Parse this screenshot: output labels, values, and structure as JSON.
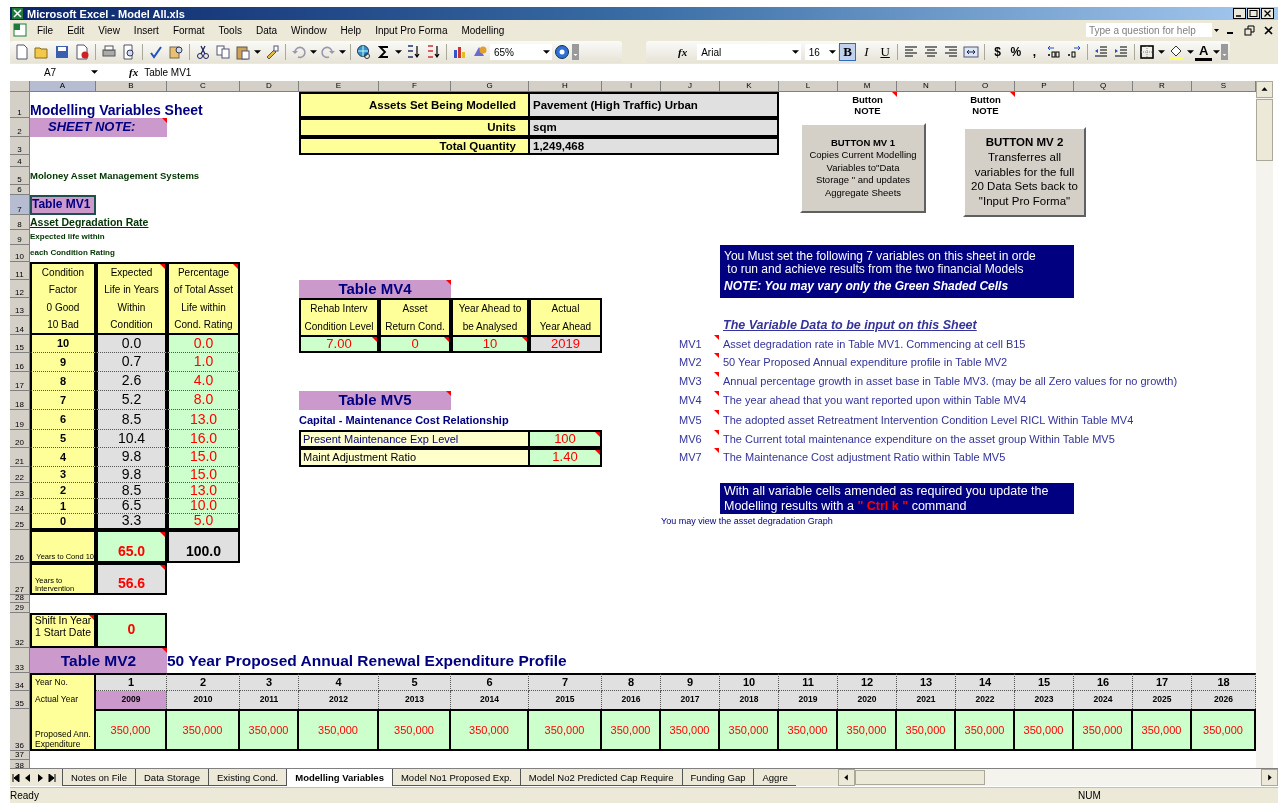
{
  "window": {
    "title": "Microsoft Excel - Model All.xls"
  },
  "menu_bar": [
    "File",
    "Edit",
    "View",
    "Insert",
    "Format",
    "Tools",
    "Data",
    "Window",
    "Help",
    "Input Pro Forma",
    "Modelling"
  ],
  "help_box": {
    "placeholder": "Type a question for help"
  },
  "toolbar": {
    "function_label": "fx",
    "zoom": "65%",
    "font": "Arial",
    "font_size": "16",
    "style_buttons": [
      {
        "label": "B",
        "pressed": true
      },
      {
        "label": "I",
        "pressed": false
      },
      {
        "label": "U",
        "pressed": false
      }
    ],
    "number_buttons": [
      "$",
      "%",
      ","
    ],
    "font_color_label": "A"
  },
  "formula_bar": {
    "cell": "A7",
    "function_label": "fx",
    "content": "Table MV1"
  },
  "column_headers": [
    {
      "label": "A",
      "selected": true
    },
    {
      "label": "B",
      "selected": false
    },
    {
      "label": "C",
      "selected": false
    },
    {
      "label": "D",
      "selected": false
    },
    {
      "label": "E",
      "selected": false
    },
    {
      "label": "F",
      "selected": false
    },
    {
      "label": "G",
      "selected": false
    },
    {
      "label": "H",
      "selected": false
    },
    {
      "label": "I",
      "selected": false
    },
    {
      "label": "J",
      "selected": false
    },
    {
      "label": "K",
      "selected": false
    },
    {
      "label": "L",
      "selected": false
    },
    {
      "label": "M",
      "selected": false
    },
    {
      "label": "N",
      "selected": false
    },
    {
      "label": "O",
      "selected": false
    },
    {
      "label": "P",
      "selected": false
    },
    {
      "label": "Q",
      "selected": false
    },
    {
      "label": "R",
      "selected": false
    },
    {
      "label": "S",
      "selected": false
    }
  ],
  "row_headers": [
    {
      "label": "1",
      "selected": false
    },
    {
      "label": "2",
      "selected": false
    },
    {
      "label": "3",
      "selected": false
    },
    {
      "label": "4",
      "selected": false
    },
    {
      "label": "5",
      "selected": false
    },
    {
      "label": "6",
      "selected": false
    },
    {
      "label": "7",
      "selected": true
    },
    {
      "label": "8",
      "selected": false
    },
    {
      "label": "9",
      "selected": false
    },
    {
      "label": "10",
      "selected": false
    },
    {
      "label": "11",
      "selected": false
    },
    {
      "label": "12",
      "selected": false
    },
    {
      "label": "13",
      "selected": false
    },
    {
      "label": "14",
      "selected": false
    },
    {
      "label": "15",
      "selected": false
    },
    {
      "label": "16",
      "selected": false
    },
    {
      "label": "17",
      "selected": false
    },
    {
      "label": "18",
      "selected": false
    },
    {
      "label": "19",
      "selected": false
    },
    {
      "label": "20",
      "selected": false
    },
    {
      "label": "21",
      "selected": false
    },
    {
      "label": "22",
      "selected": false
    },
    {
      "label": "23",
      "selected": false
    },
    {
      "label": "24",
      "selected": false
    },
    {
      "label": "25",
      "selected": false
    },
    {
      "label": "26",
      "selected": false
    },
    {
      "label": "27",
      "selected": false
    },
    {
      "label": "28",
      "selected": false
    },
    {
      "label": "29",
      "selected": false
    },
    {
      "label": "32",
      "selected": false
    },
    {
      "label": "33",
      "selected": false
    },
    {
      "label": "34",
      "selected": false
    },
    {
      "label": "35",
      "selected": false
    },
    {
      "label": "36",
      "selected": false
    },
    {
      "label": "37",
      "selected": false
    },
    {
      "label": "38",
      "selected": false
    }
  ],
  "sheet": {
    "title": "Modelling Variables Sheet",
    "sheet_note": {
      "text": "SHEET NOTE:",
      "comment": true
    },
    "company": "Moloney Asset Management Systems",
    "assets_table": [
      {
        "label": "Assets Set Being Modelled",
        "value": "Pavement (High Traffic) Urban"
      },
      {
        "label": "Units",
        "value": "sqm"
      },
      {
        "label": "Total Quantity",
        "value": "1,249,468"
      }
    ],
    "button_notes": [
      {
        "lines": [
          "Button",
          "NOTE"
        ],
        "comment": true
      },
      {
        "lines": [
          "Button",
          "NOTE"
        ],
        "comment": true
      }
    ],
    "buttons": [
      {
        "title": "BUTTON MV 1",
        "lines": [
          "Copies Current Modelling",
          "Variables to\"Data",
          "Storage \" and updates",
          "Aggregate Sheets"
        ]
      },
      {
        "title": "BUTTON MV 2",
        "lines": [
          "Transferres all",
          "variables for the full",
          "20 Data Sets back to",
          "\"Input Pro Forma\""
        ]
      }
    ],
    "mv1": {
      "title": "Table MV1",
      "subtitle": "Asset Degradation Rate",
      "caption": [
        "Expected life within",
        "each Condition Rating"
      ],
      "headers": [
        {
          "lines": [
            "Condition",
            "Factor",
            "0 Good",
            "10 Bad"
          ],
          "comment": false
        },
        {
          "lines": [
            "Expected",
            "Life in Years",
            "Within",
            "Condition"
          ],
          "comment": true
        },
        {
          "lines": [
            "Percentage",
            "of Total Asset",
            "Life within",
            "Cond. Rating"
          ],
          "comment": true
        }
      ],
      "rows": [
        {
          "factor": "10",
          "life": "0.0",
          "percent": "0.0"
        },
        {
          "factor": "9",
          "life": "0.7",
          "percent": "1.0"
        },
        {
          "factor": "8",
          "life": "2.6",
          "percent": "4.0"
        },
        {
          "factor": "7",
          "life": "5.2",
          "percent": "8.0"
        },
        {
          "factor": "6",
          "life": "8.5",
          "percent": "13.0"
        },
        {
          "factor": "5",
          "life": "10.4",
          "percent": "16.0"
        },
        {
          "factor": "4",
          "life": "9.8",
          "percent": "15.0"
        },
        {
          "factor": "3",
          "life": "9.8",
          "percent": "15.0"
        },
        {
          "factor": "2",
          "life": "8.5",
          "percent": "13.0"
        },
        {
          "factor": "1",
          "life": "6.5",
          "percent": "10.0"
        },
        {
          "factor": "0",
          "life": "3.3",
          "percent": "5.0"
        }
      ],
      "total": {
        "label": "Years to Cond 10",
        "life": "65.0",
        "percent": "100.0"
      },
      "intervention": {
        "label": "Years to Intervention",
        "value": "56.6"
      }
    },
    "shift": {
      "lines": [
        "Shift In Year",
        "1 Start Date"
      ],
      "value": "0"
    },
    "mv4": {
      "title": "Table MV4",
      "columns": [
        {
          "lines": [
            "Rehab Interv",
            "Condition Level"
          ],
          "value": "7.00",
          "kind": "input"
        },
        {
          "lines": [
            "Asset",
            "Return Cond."
          ],
          "value": "0",
          "kind": "input"
        },
        {
          "lines": [
            "Year Ahead to",
            "be Analysed"
          ],
          "value": "10",
          "kind": "input"
        },
        {
          "lines": [
            "Actual",
            "Year Ahead"
          ],
          "value": "2019",
          "kind": "computed"
        }
      ]
    },
    "mv5": {
      "title": "Table MV5",
      "subtitle": "Capital - Maintenance Cost Relationship",
      "rows": [
        {
          "label": "Present Maintenance Exp Level",
          "value": "100"
        },
        {
          "label": "Maint Adjustment Ratio",
          "value": "1.40"
        }
      ]
    },
    "notice": {
      "lines": [
        "You Must set the following 7 variables on this sheet in orde",
        " to run and achieve results from the two financial Models"
      ],
      "note": "NOTE: You may vary only the Green Shaded Cells"
    },
    "variables": {
      "title": "The Variable Data to be input on this Sheet",
      "items": [
        {
          "code": "MV1",
          "text": "Asset degradation rate in Table MV1. Commencing at cell B15"
        },
        {
          "code": "MV2",
          "text": "50 Year Proposed Annual expenditure profile in Table MV2"
        },
        {
          "code": "MV3",
          "text": "Annual percentage growth in asset base in Table MV3. (may be all Zero values for no growth)"
        },
        {
          "code": "MV4",
          "text": "The year ahead that you want reported upon within Table MV4"
        },
        {
          "code": "MV5",
          "text": "The adopted asset Retreatment Intervention Condition Level RICL Within Table MV4"
        },
        {
          "code": "MV6",
          "text": "The Current total maintenance expenditure on the asset group Within Table MV5"
        },
        {
          "code": "MV7",
          "text": "The Maintenance Cost adjustment Ratio within Table MV5"
        }
      ]
    },
    "update_notice": [
      "With all variable cells amended as required you update the",
      "Modelling results with a **\" Ctrl k \"** command"
    ],
    "graph_link": "You may view the asset degradation Graph",
    "mv2": {
      "title": "Table MV2",
      "heading": "50 Year Proposed Annual Renewal Expenditure Profile",
      "row_labels": [
        "Year No.",
        "Actual Year",
        "Proposed Ann. Expenditure"
      ],
      "years": [
        {
          "number": "1",
          "year": "2009",
          "amount": "350,000",
          "selected": true
        },
        {
          "number": "2",
          "year": "2010",
          "amount": "350,000",
          "selected": false
        },
        {
          "number": "3",
          "year": "2011",
          "amount": "350,000",
          "selected": false
        },
        {
          "number": "4",
          "year": "2012",
          "amount": "350,000",
          "selected": false
        },
        {
          "number": "5",
          "year": "2013",
          "amount": "350,000",
          "selected": false
        },
        {
          "number": "6",
          "year": "2014",
          "amount": "350,000",
          "selected": false
        },
        {
          "number": "7",
          "year": "2015",
          "amount": "350,000",
          "selected": false
        },
        {
          "number": "8",
          "year": "2016",
          "amount": "350,000",
          "selected": false
        },
        {
          "number": "9",
          "year": "2017",
          "amount": "350,000",
          "selected": false
        },
        {
          "number": "10",
          "year": "2018",
          "amount": "350,000",
          "selected": false
        },
        {
          "number": "11",
          "year": "2019",
          "amount": "350,000",
          "selected": false
        },
        {
          "number": "12",
          "year": "2020",
          "amount": "350,000",
          "selected": false
        },
        {
          "number": "13",
          "year": "2021",
          "amount": "350,000",
          "selected": false
        },
        {
          "number": "14",
          "year": "2022",
          "amount": "350,000",
          "selected": false
        },
        {
          "number": "15",
          "year": "2023",
          "amount": "350,000",
          "selected": false
        },
        {
          "number": "16",
          "year": "2024",
          "amount": "350,000",
          "selected": false
        },
        {
          "number": "17",
          "year": "2025",
          "amount": "350,000",
          "selected": false
        },
        {
          "number": "18",
          "year": "2026",
          "amount": "350,000",
          "selected": false
        }
      ]
    }
  },
  "sheet_tabs": [
    {
      "label": "Notes on File",
      "selected": false
    },
    {
      "label": "Data Storage",
      "selected": false
    },
    {
      "label": "Existing Cond.",
      "selected": false
    },
    {
      "label": "Modelling Variables",
      "selected": true
    },
    {
      "label": "Model No1 Proposed Exp.",
      "selected": false
    },
    {
      "label": "Model No2 Predicted Cap Require",
      "selected": false
    },
    {
      "label": "Funding Gap",
      "selected": false
    },
    {
      "label": "Aggre",
      "selected": false
    }
  ],
  "status_bar": {
    "text": "Ready",
    "num": "NUM"
  }
}
